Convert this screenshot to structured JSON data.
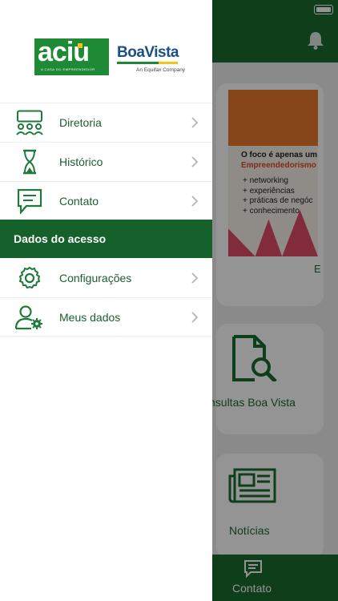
{
  "colors": {
    "brand_green": "#1b6b30",
    "menu_text": "#1b5e31",
    "section_bg": "#16602b",
    "overlay": "rgba(0,0,0,0.42)"
  },
  "drawer": {
    "logo_left": {
      "word": "aciu",
      "tagline": "A CASA DO EMPREENDEDOR"
    },
    "logo_right": {
      "name": "BoaVista",
      "tagline": "An Equifax Company"
    },
    "menu": [
      {
        "label": "Diretoria",
        "icon": "group-meeting-icon"
      },
      {
        "label": "Histórico",
        "icon": "hourglass-icon"
      },
      {
        "label": "Contato",
        "icon": "chat-icon"
      }
    ],
    "section_title": "Dados do acesso",
    "account_menu": [
      {
        "label": "Configurações",
        "icon": "gear-icon"
      },
      {
        "label": "Meus dados",
        "icon": "user-settings-icon"
      }
    ]
  },
  "background": {
    "banner": {
      "headline": "O foco é apenas um",
      "highlight": "Empreendedorismo",
      "bullets": [
        "+ networking",
        "+ experiências",
        "+ práticas de negóc",
        "+ conhecimento"
      ],
      "edge_text": "E"
    },
    "cards": [
      {
        "label": "nsultas Boa Vista",
        "icon": "document-search-icon"
      },
      {
        "label": "Notícias",
        "icon": "newspaper-icon"
      }
    ],
    "tab": {
      "label": "Contato",
      "icon": "chat-icon"
    }
  }
}
